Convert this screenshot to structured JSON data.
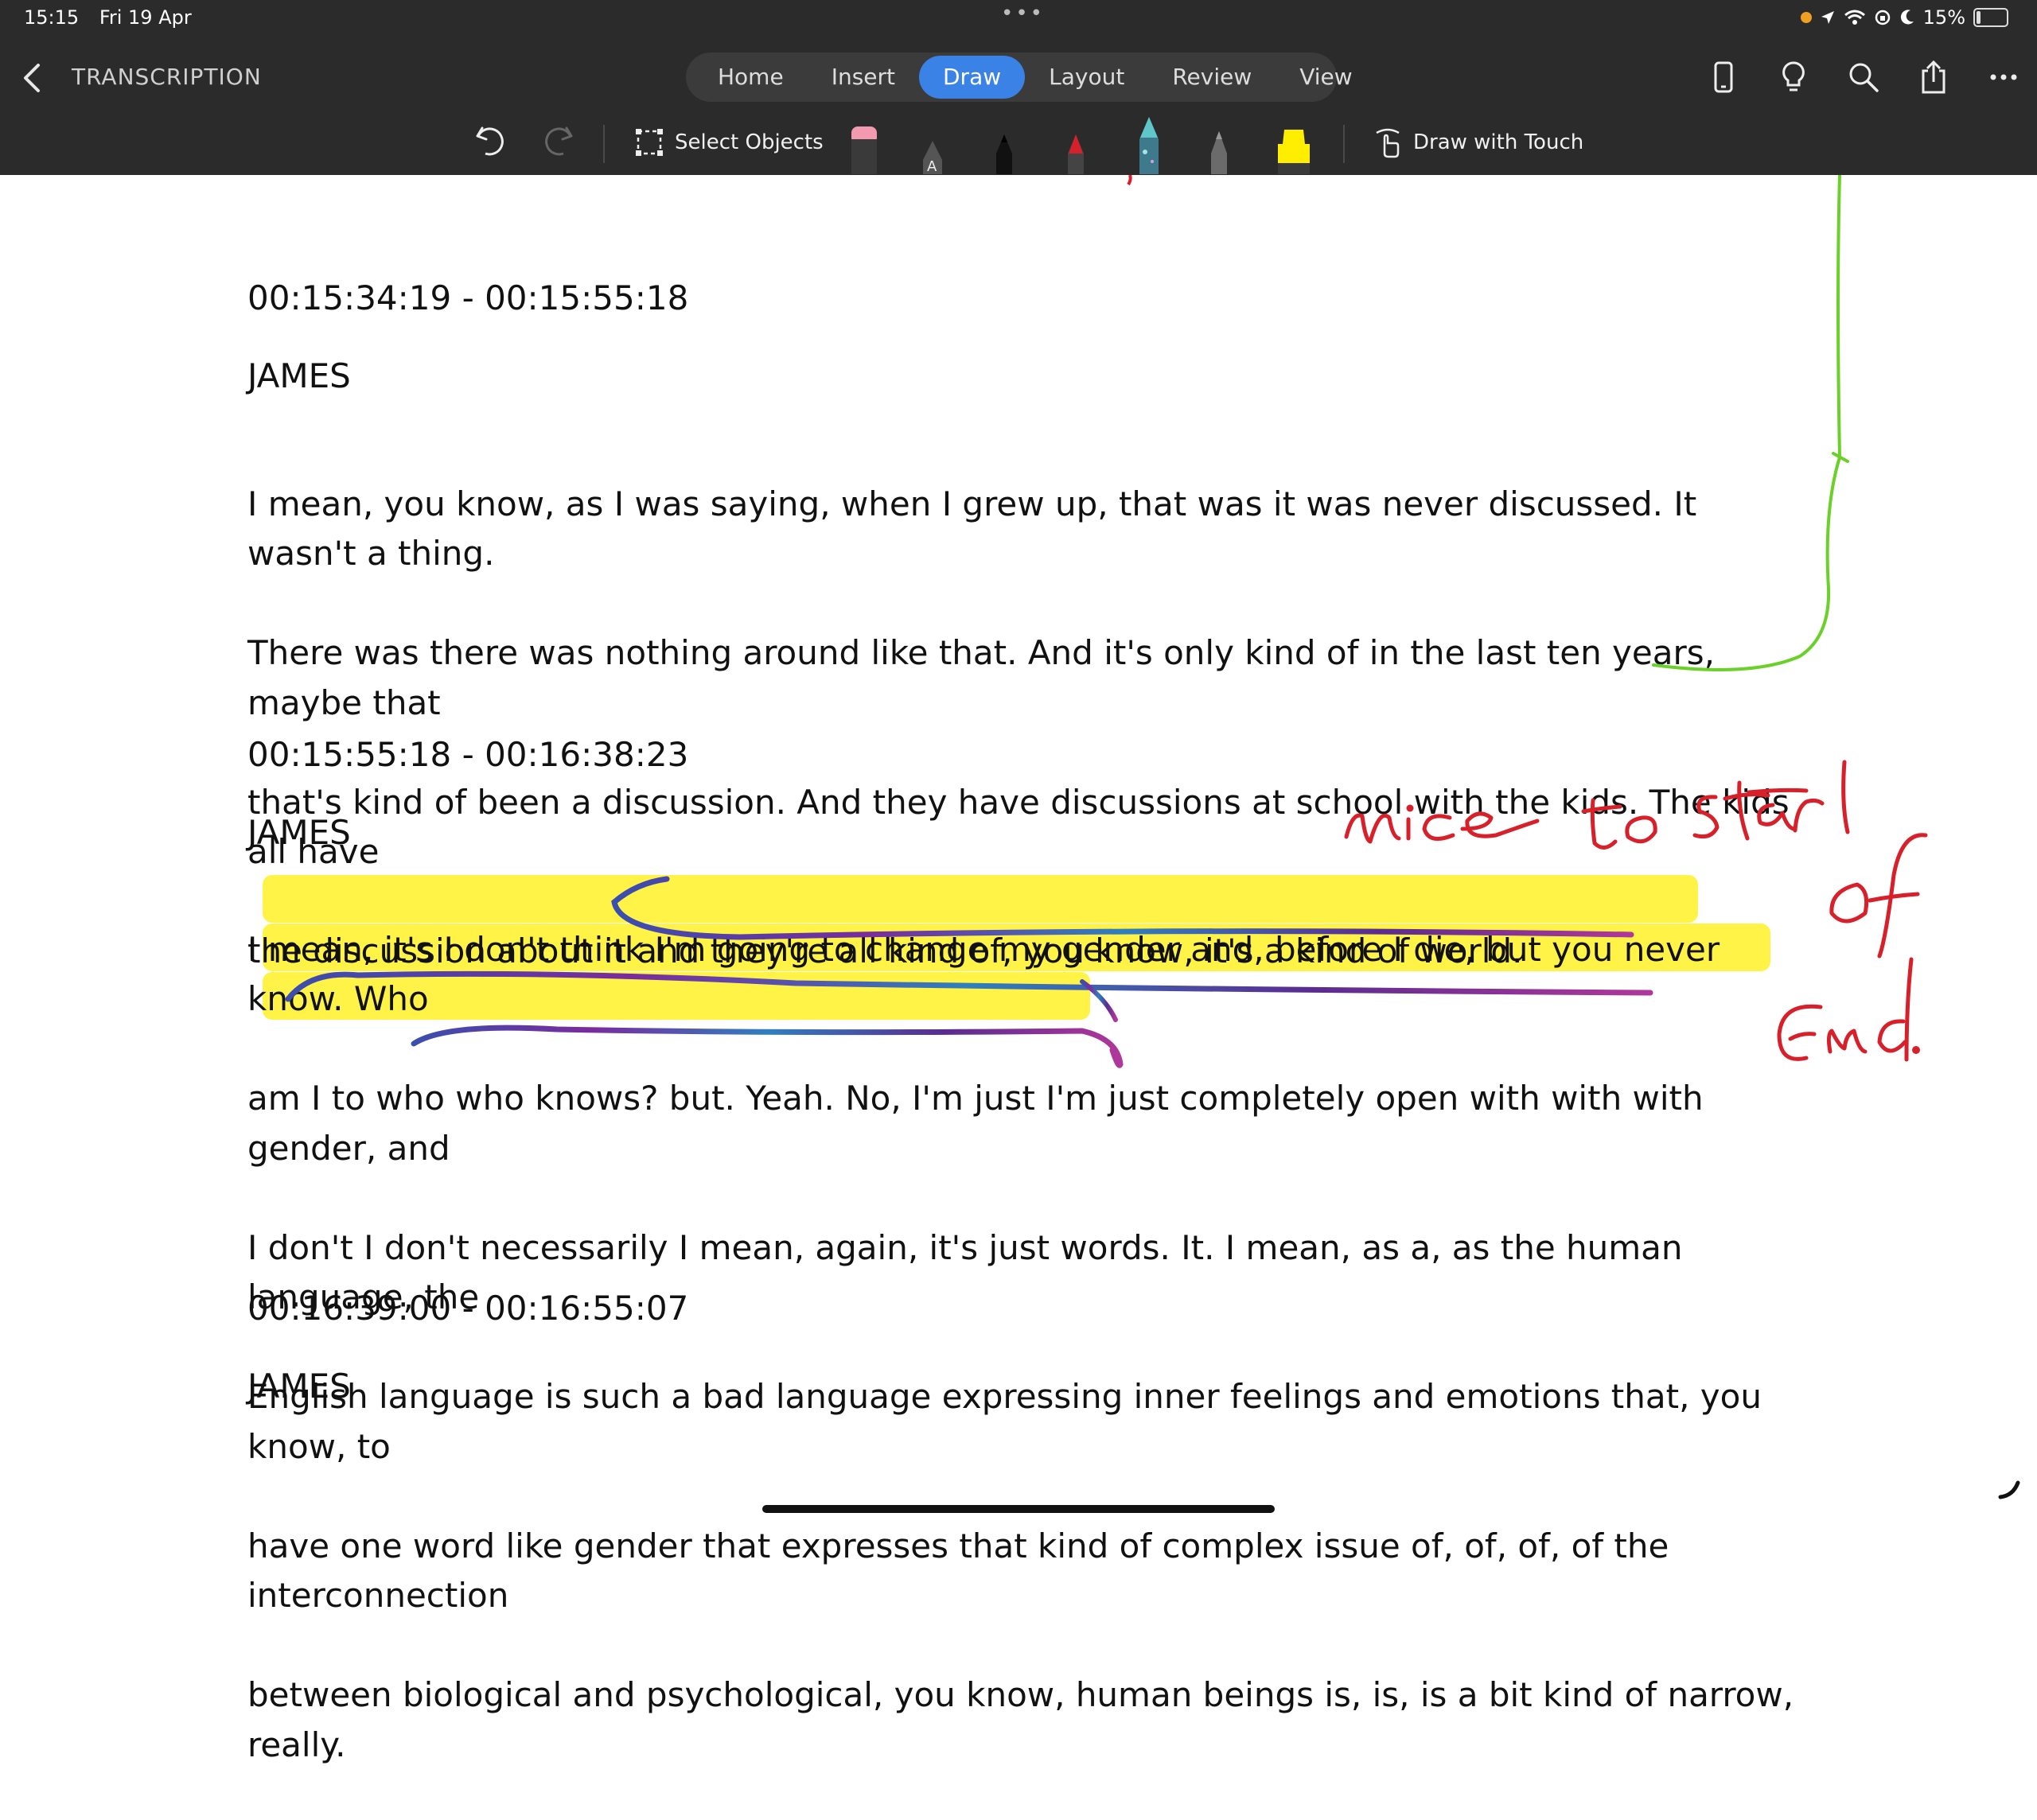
{
  "status_bar": {
    "time": "15:15",
    "date": "Fri 19 Apr",
    "battery": "15%"
  },
  "header": {
    "doc_title": "TRANSCRIPTION",
    "tabs": [
      {
        "label": "Home"
      },
      {
        "label": "Insert"
      },
      {
        "label": "Draw",
        "active": true
      },
      {
        "label": "Layout"
      },
      {
        "label": "Review"
      },
      {
        "label": "View"
      }
    ],
    "icons": [
      "phone-view-icon",
      "lightbulb-icon",
      "search-icon",
      "share-icon",
      "more-icon"
    ]
  },
  "draw_toolbar": {
    "select_objects_label": "Select Objects",
    "draw_with_touch_label": "Draw with Touch",
    "tools": [
      "eraser",
      "pen-black-a",
      "pen-black",
      "pen-red",
      "pen-galaxy",
      "pencil-gray",
      "highlighter-yellow"
    ],
    "colors": {
      "red": "#d8202a",
      "highlight": "#ffee00",
      "green": "#6bd12a",
      "accent": "#3b82e6"
    }
  },
  "document": {
    "sections": [
      {
        "timecode": "00:15:34:19 - 00:15:55:18",
        "speaker": "JAMES",
        "lines": [
          "I mean, you know, as I was saying, when I grew up, that was it was never discussed. It wasn't a thing.",
          "There was there was nothing around like that. And it's only kind of in the last ten years, maybe that",
          "that's kind of been a discussion. And they have discussions at school with the kids. The kids all have",
          "the discussion about it and they're all kind of, you know, it's a kind of world."
        ]
      },
      {
        "timecode": "00:15:55:18 - 00:16:38:23",
        "speaker": "JAMES",
        "lines": [
          "I mean, it's I don't think I'm going to change my gender and, before I die, but you never know. Who",
          "am I to who who knows? but. Yeah. No, I'm just I'm just completely open with with with gender, and",
          "I don't I don't necessarily I mean, again, it's just words. It. I mean, as a, as the human language, the",
          "English language is such a bad language expressing inner feelings and emotions that, you know, to",
          "have one word like gender that expresses that kind of complex issue of, of, of, of the interconnection",
          "between biological and psychological, you know, human beings is, is, is a bit kind of narrow, really."
        ]
      },
      {
        "timecode": "00:16:39:00 - 00:16:55:07",
        "speaker": "JAMES"
      }
    ],
    "handwritten_annotation": "nice to start of end."
  }
}
